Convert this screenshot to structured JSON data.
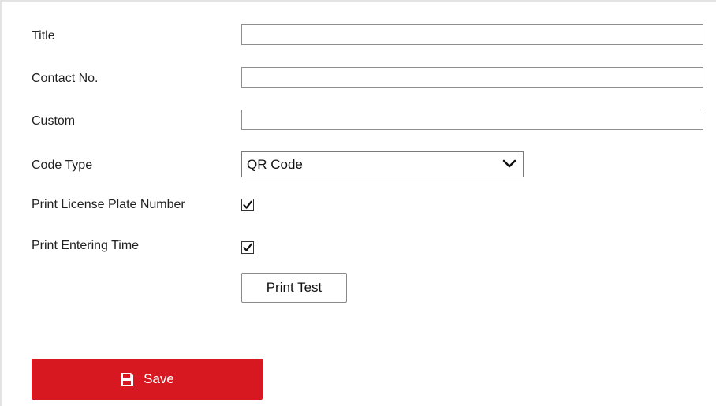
{
  "form": {
    "title_label": "Title",
    "title_value": "",
    "contact_label": "Contact No.",
    "contact_value": "",
    "custom_label": "Custom",
    "custom_value": "",
    "code_type_label": "Code Type",
    "code_type_value": "QR Code",
    "print_plate_label": "Print License Plate Number",
    "print_plate_checked": true,
    "print_time_label": "Print Entering Time",
    "print_time_checked": true,
    "print_test_label": "Print Test"
  },
  "save": {
    "label": "Save",
    "icon": "floppy-disk-icon",
    "color": "#d71820"
  }
}
